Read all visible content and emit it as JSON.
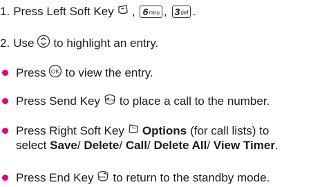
{
  "steps": [
    {
      "number": "1.",
      "text_a": "Press Left Soft Key",
      "sep1": ",",
      "key1_main": "6",
      "key1_sub": "mno",
      "sep2": ",",
      "key2_main": "3",
      "key2_sub": "def",
      "end": "."
    },
    {
      "number": "2.",
      "text_a": "Use",
      "text_b": "to highlight an entry."
    }
  ],
  "bullets": [
    {
      "text_a": "Press",
      "text_b": "to view the entry."
    },
    {
      "text_a": "Press Send Key",
      "text_b": "to place a call to the number."
    },
    {
      "text_a": "Press Right Soft Key",
      "bold_a": "Options",
      "text_b": "(for call lists) to",
      "line2_a": "select",
      "opt1": "Save",
      "slash1": "/",
      "opt2": "Delete",
      "slash2": "/",
      "opt3": "Call",
      "slash3": "/",
      "opt4": "Delete All",
      "slash4": "/",
      "opt5": "View Timer",
      "line2_end": "."
    },
    {
      "text_a": "Press End Key",
      "text_b": "to return to the standby mode."
    }
  ],
  "icons": {
    "left_soft_key": "left-soft-key-icon",
    "nav_key": "navigation-key-icon",
    "ok_key": "ok-key-icon",
    "send_key": "send-key-icon",
    "right_soft_key": "right-soft-key-icon",
    "end_key": "end-key-icon"
  },
  "colors": {
    "bullet": "#e4007f",
    "text": "#1a1a1a"
  }
}
